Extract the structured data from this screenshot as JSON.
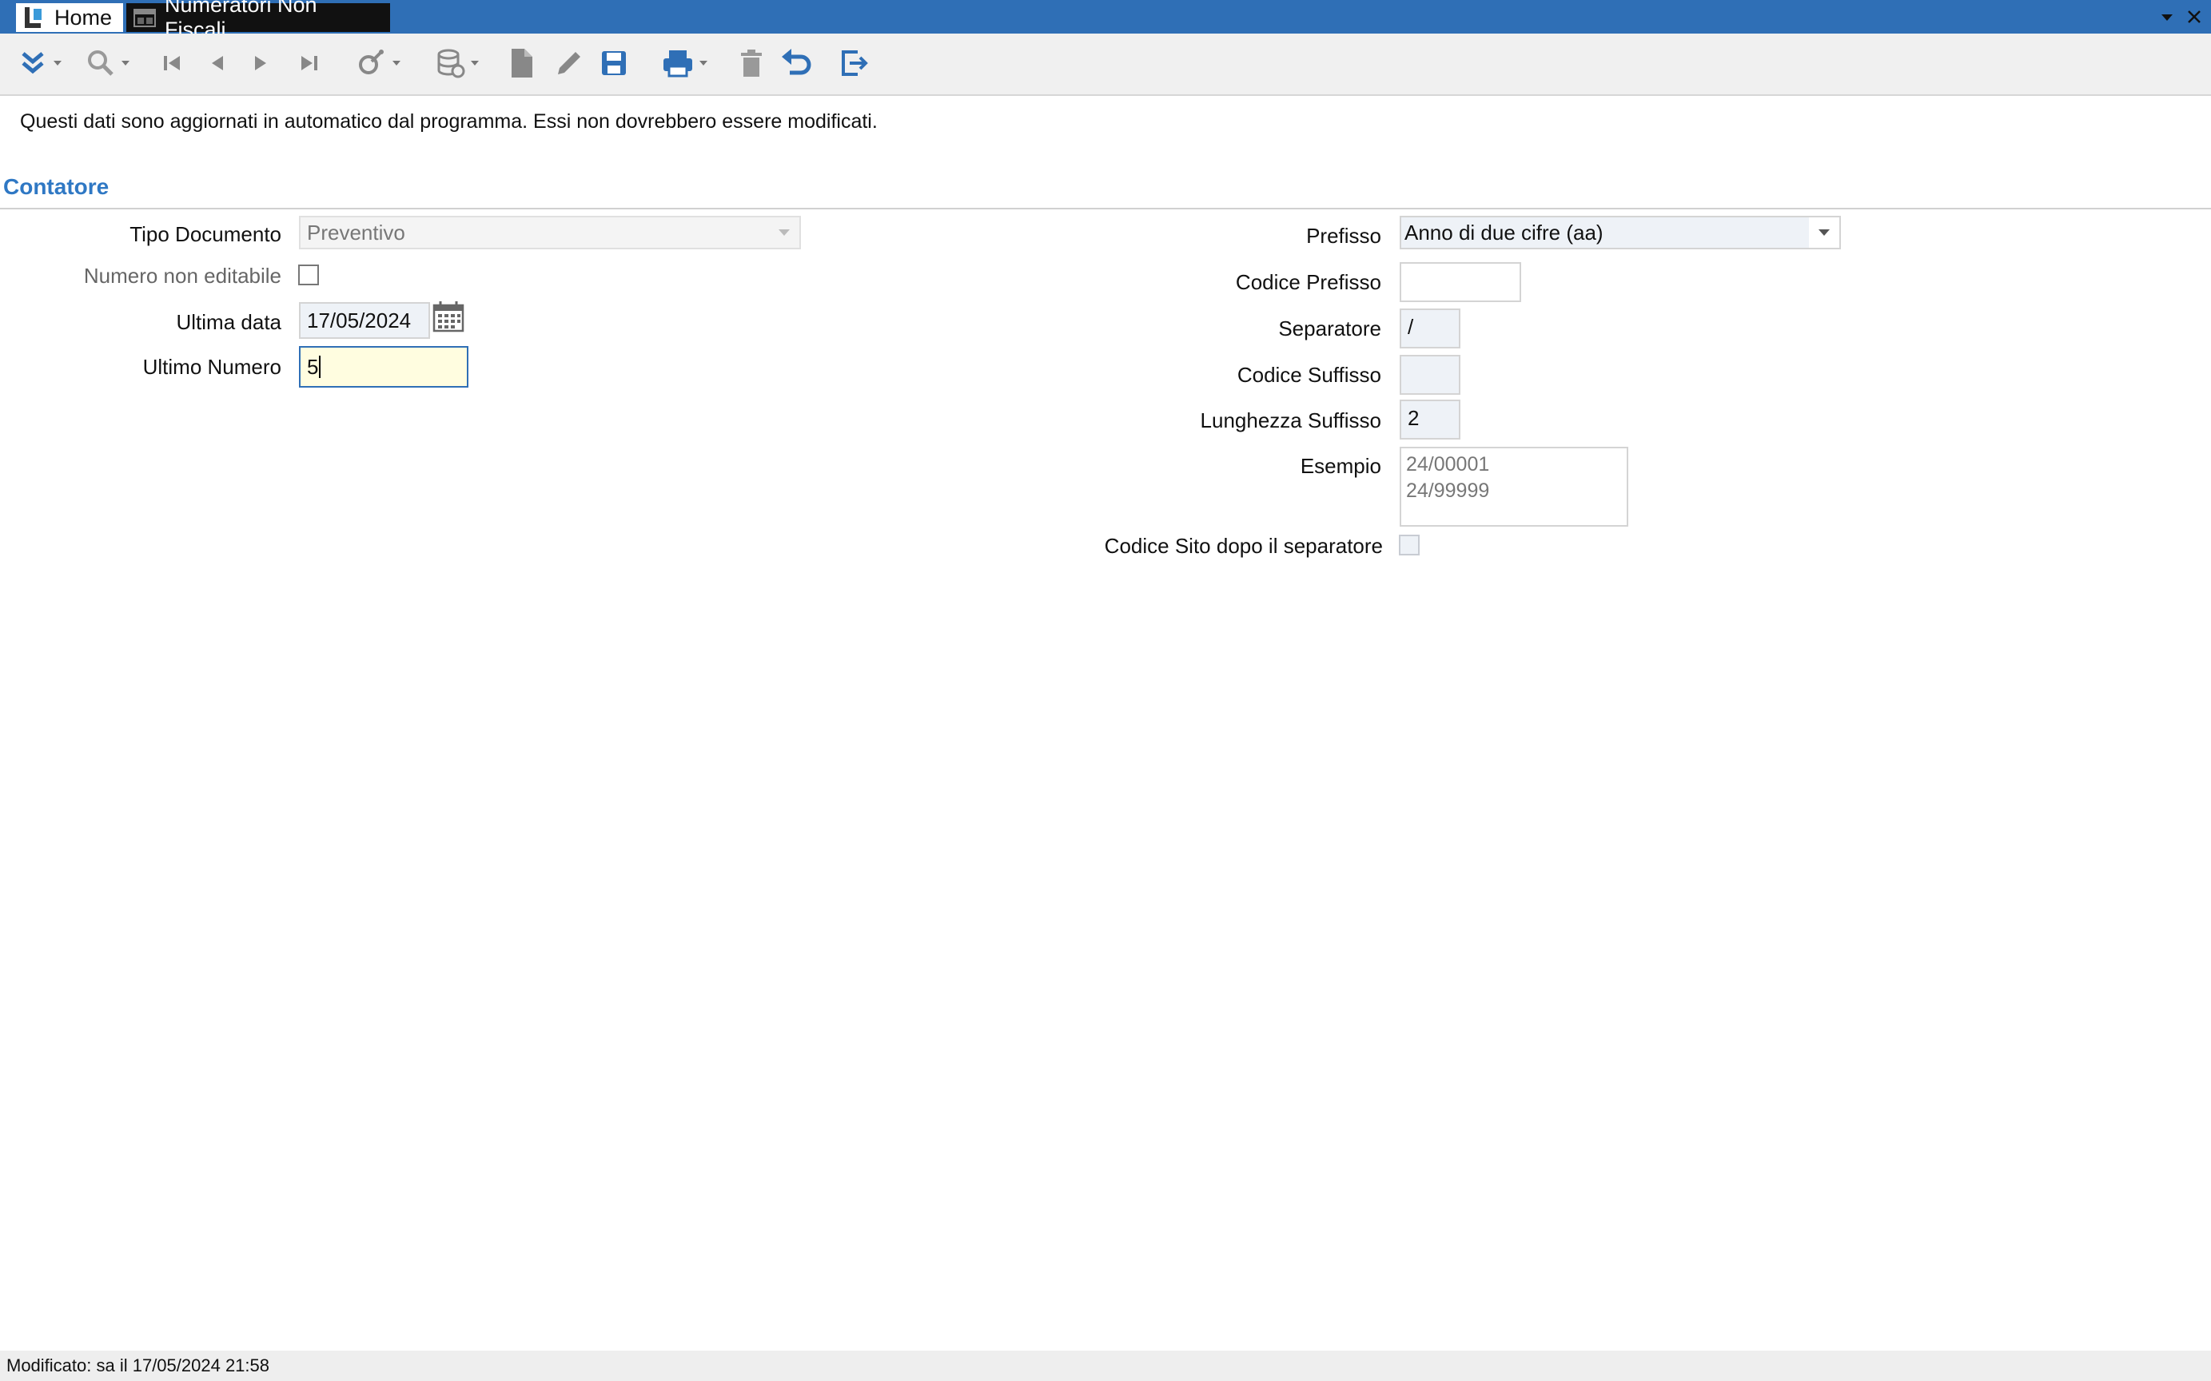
{
  "tabs": {
    "home_label": "Home",
    "active_label": "Numeratori Non Fiscali"
  },
  "toolbar": {
    "buttons": [
      {
        "name": "expand-menu-icon",
        "has_dropdown": true
      },
      {
        "name": "search-icon",
        "has_dropdown": true
      },
      {
        "name": "first-record-icon"
      },
      {
        "name": "previous-record-icon"
      },
      {
        "name": "next-record-icon"
      },
      {
        "name": "last-record-icon"
      },
      {
        "name": "filter-wand-icon",
        "has_dropdown": true
      },
      {
        "name": "database-sync-icon",
        "has_dropdown": true
      },
      {
        "name": "new-document-icon"
      },
      {
        "name": "edit-pencil-icon"
      },
      {
        "name": "save-disk-icon"
      },
      {
        "name": "print-icon",
        "has_dropdown": true
      },
      {
        "name": "delete-trash-icon"
      },
      {
        "name": "undo-icon"
      },
      {
        "name": "exit-icon"
      }
    ],
    "accent_color": "#2f6fb6"
  },
  "notice": "Questi dati sono aggiornati in automatico dal programma. Essi non dovrebbero essere modificati.",
  "section": {
    "title": "Contatore"
  },
  "left_form": {
    "tipo_documento": {
      "label": "Tipo Documento",
      "value": "Preventivo"
    },
    "numero_non_editabile": {
      "label": "Numero non editabile",
      "checked": false
    },
    "ultima_data": {
      "label": "Ultima data",
      "value": "17/05/2024"
    },
    "ultimo_numero": {
      "label": "Ultimo Numero",
      "value": "5"
    }
  },
  "right_form": {
    "prefisso": {
      "label": "Prefisso",
      "value": "Anno di due cifre (aa)"
    },
    "codice_prefisso": {
      "label": "Codice Prefisso",
      "value": ""
    },
    "separatore": {
      "label": "Separatore",
      "value": "/"
    },
    "codice_suffisso": {
      "label": "Codice Suffisso",
      "value": ""
    },
    "lunghezza_suffisso": {
      "label": "Lunghezza Suffisso",
      "value": "2"
    },
    "esempio": {
      "label": "Esempio",
      "line1": "24/00001",
      "line2": "24/99999"
    },
    "codice_sito": {
      "label": "Codice Sito dopo il separatore",
      "checked": false
    }
  },
  "status": {
    "text": "Modificato: sa il 17/05/2024 21:58"
  },
  "colors": {
    "titlebar": "#2f6fb6",
    "section_title": "#2f78c4",
    "active_field_bg": "#fffde0"
  }
}
